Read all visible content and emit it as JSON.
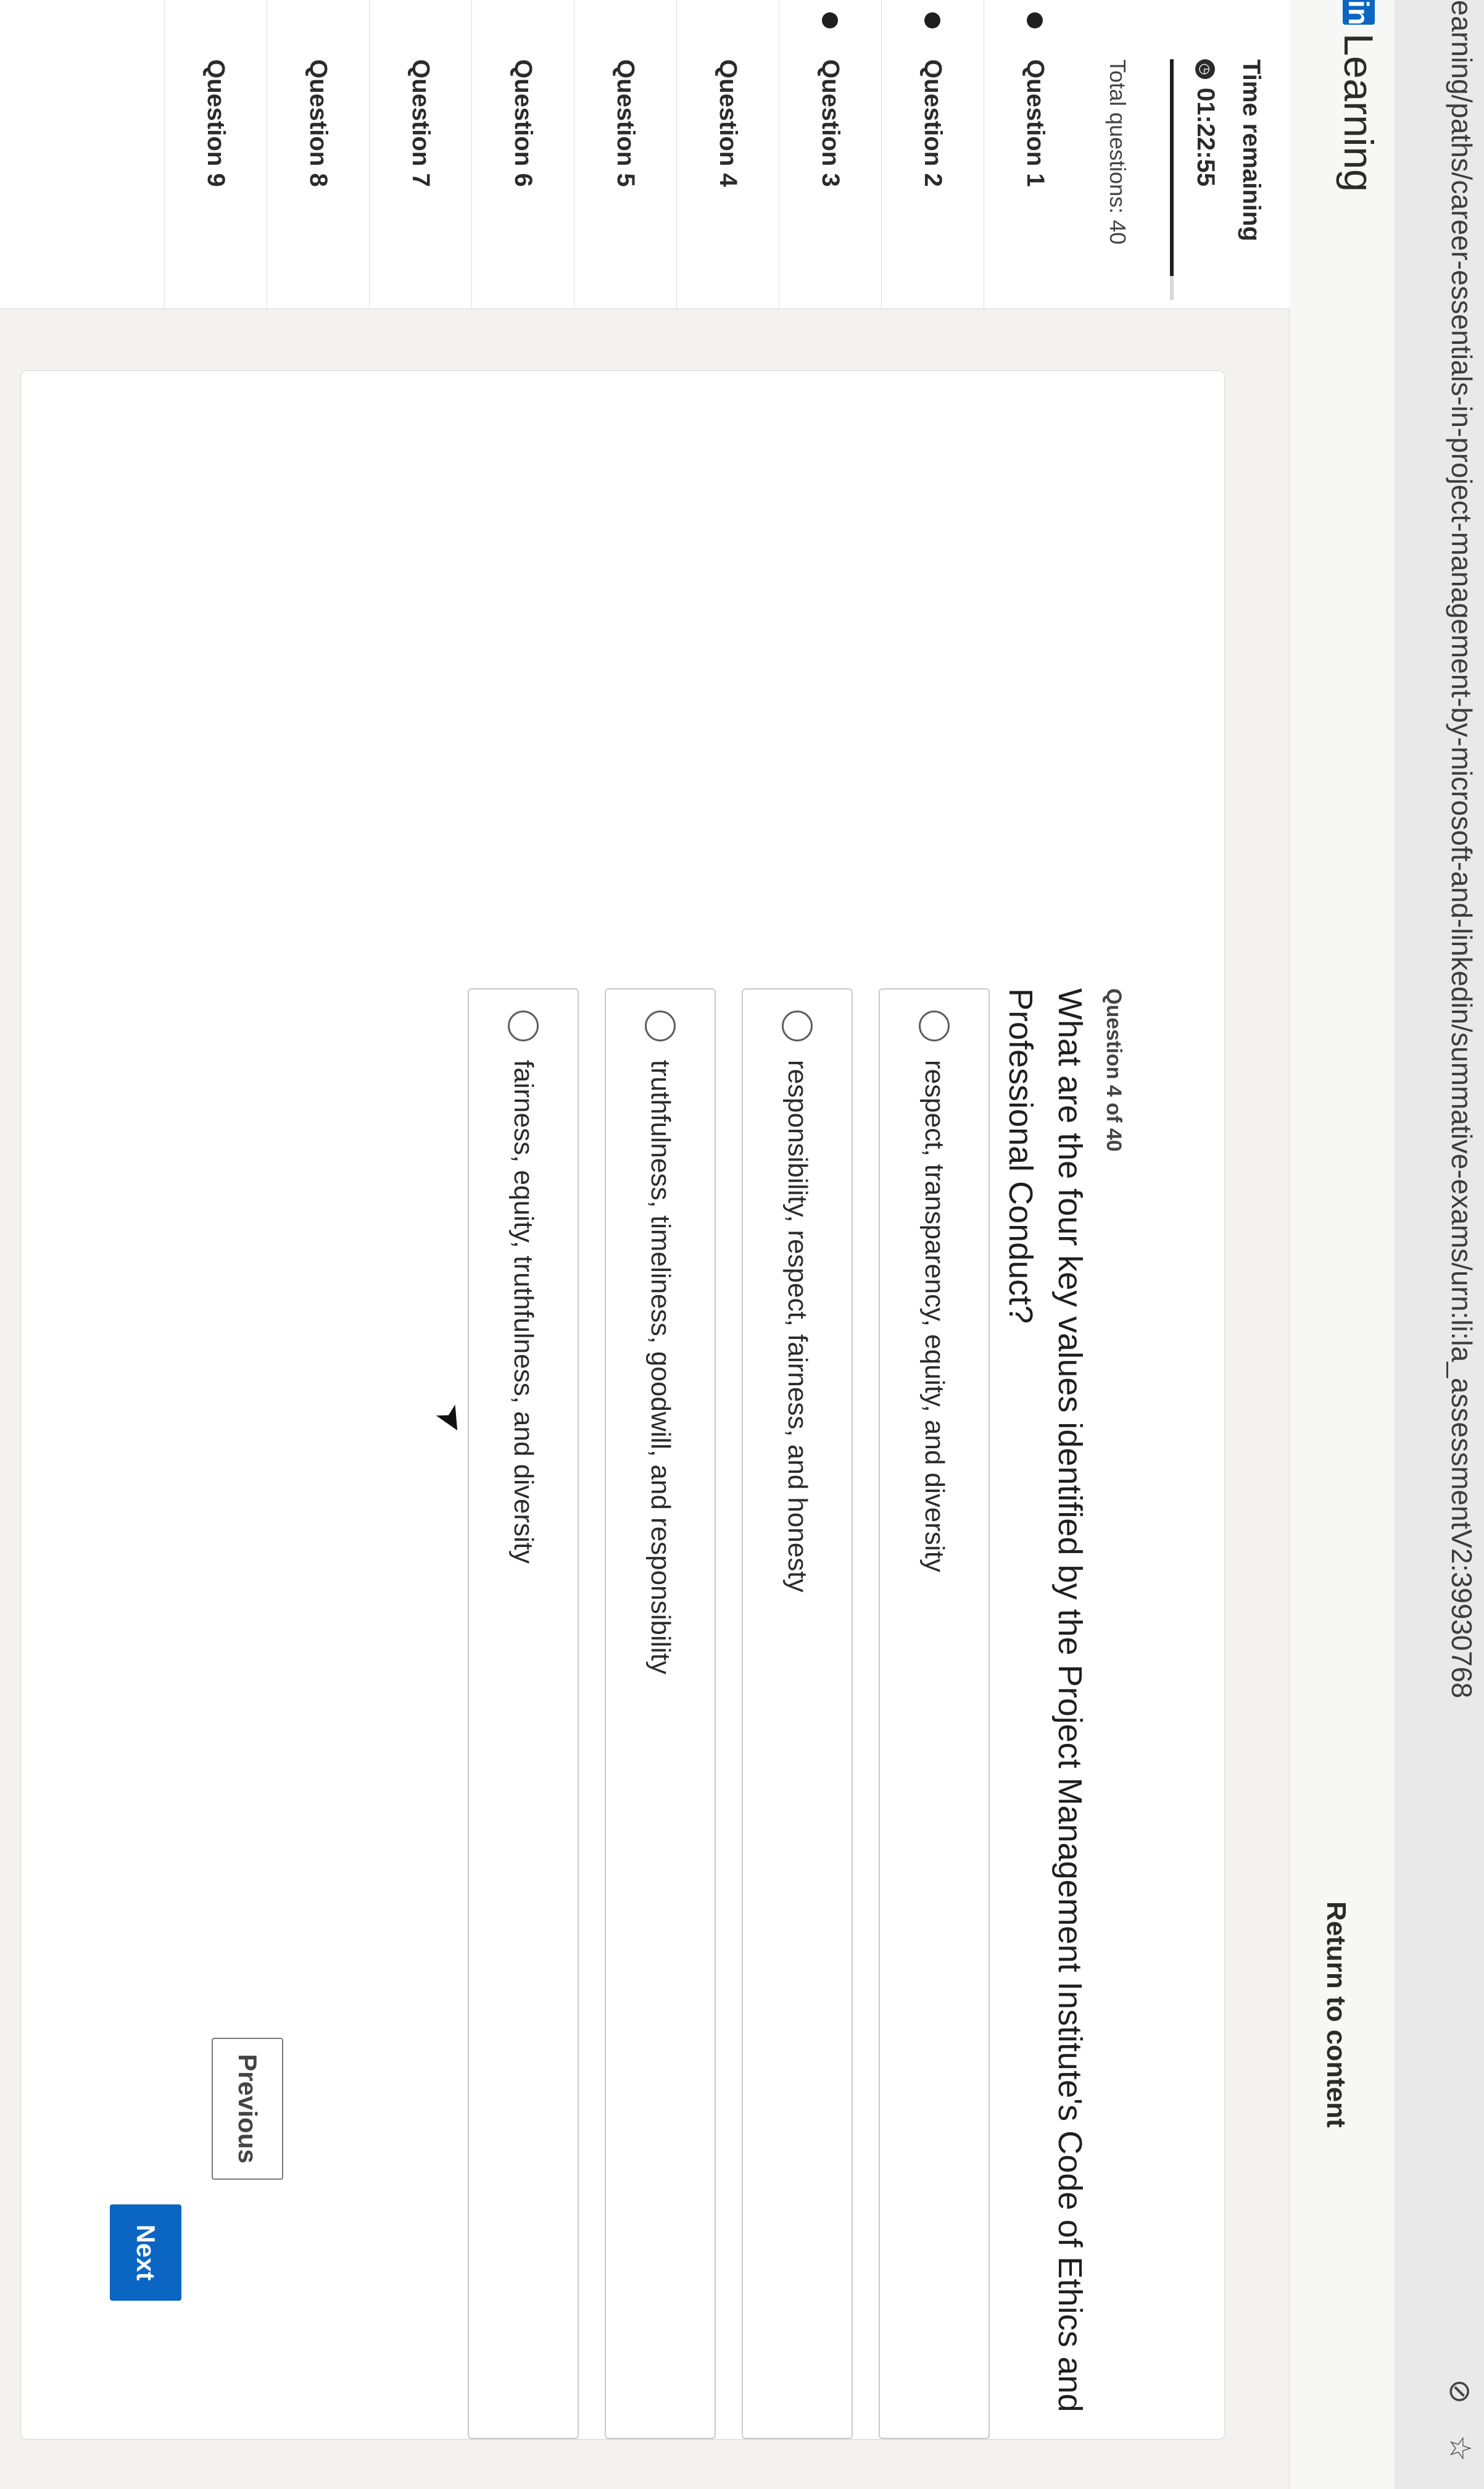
{
  "browser": {
    "url": "earning/paths/career-essentials-in-project-management-by-microsoft-and-linkedin/summative-exams/urn:li:la_assessmentV2:39930768",
    "icons": [
      "eye-slash-icon",
      "star-icon"
    ]
  },
  "header": {
    "brand_logo": "in",
    "brand_name": "Learning",
    "return_link": "Return to content"
  },
  "sidebar": {
    "time_label": "Time remaining",
    "time_value": "01:22:55",
    "time_progress": 0.9,
    "total_questions": "Total questions: 40",
    "questions": [
      {
        "label": "Question 1",
        "answered": true
      },
      {
        "label": "Question 2",
        "answered": true
      },
      {
        "label": "Question 3",
        "answered": true
      },
      {
        "label": "Question 4",
        "answered": false
      },
      {
        "label": "Question 5",
        "answered": false
      },
      {
        "label": "Question 6",
        "answered": false
      },
      {
        "label": "Question 7",
        "answered": false
      },
      {
        "label": "Question 8",
        "answered": false
      },
      {
        "label": "Question 9",
        "answered": false
      }
    ]
  },
  "question": {
    "counter": "Question 4 of 40",
    "text": "What are the four key values identified by the Project Management Institute's Code of Ethics and Professional Conduct?",
    "options": [
      "respect, transparency, equity, and diversity",
      "responsibility, respect, fairness, and honesty",
      "truthfulness, timeliness, goodwill, and responsibility",
      "fairness, equity, truthfulness, and diversity"
    ],
    "previous_label": "Previous",
    "next_label": "Next"
  },
  "colors": {
    "accent": "#0a66c2",
    "text": "#2b2b2b",
    "background": "#f3f2ef"
  }
}
